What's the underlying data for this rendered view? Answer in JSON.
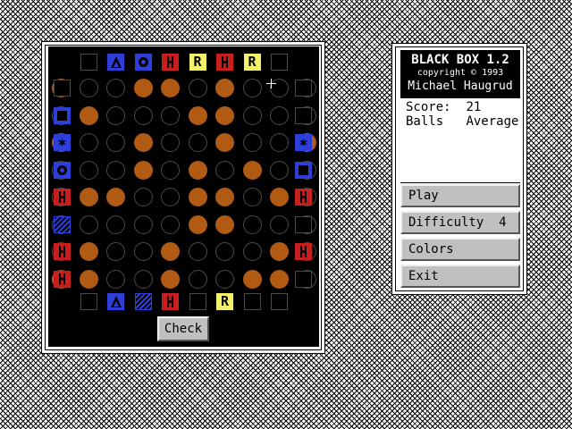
{
  "panel": {
    "title": "BLACK BOX 1.2",
    "copyright": "copyright © 1993",
    "author": "Michael Haugrud",
    "score_label": "Score:",
    "score_value": "21",
    "balls_label": "Balls",
    "difficulty_name": "Average"
  },
  "menu": {
    "play": "Play",
    "difficulty": "Difficulty",
    "difficulty_value": "4",
    "colors": "Colors",
    "exit": "Exit"
  },
  "board": {
    "check_label": "Check",
    "balls": [
      "X..XX.X...",
      ".X...XX...",
      "X..X..X..X",
      "...X.X.X..",
      ".XX..XX.X.",
      ".....XX...",
      ".X..X...X.",
      "XX..X..XX."
    ],
    "ports_top": [
      "none",
      "blue-tri",
      "blue-ring",
      "red-h",
      "yellow-r",
      "red-h",
      "yellow-r",
      "none"
    ],
    "ports_bottom": [
      "none",
      "blue-tri",
      "blue-hatch",
      "red-h",
      "none",
      "yellow-r",
      "none",
      "none"
    ],
    "ports_left": [
      "none",
      "blue-sq",
      "blue-star",
      "blue-ring",
      "red-h",
      "blue-hatch",
      "red-h",
      "red-h"
    ],
    "ports_right": [
      "none",
      "none",
      "blue-star",
      "blue-sq",
      "red-h",
      "none",
      "red-h",
      "none"
    ],
    "port_letter": "R"
  },
  "colors": {
    "ball": "#b05a14",
    "blue_marker": "#2d3fd8",
    "red_marker": "#c81e1e",
    "yellow_marker": "#f2f26a"
  }
}
